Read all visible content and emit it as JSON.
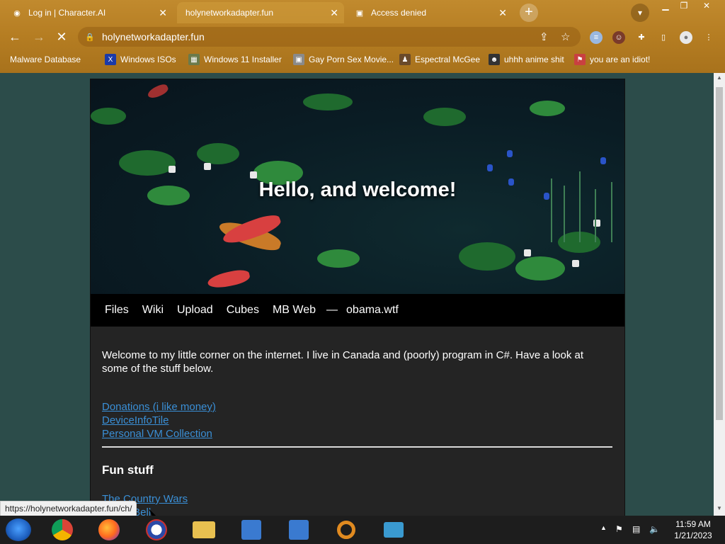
{
  "browser": {
    "tabs": [
      {
        "title": "Log in | Character.AI",
        "active": false
      },
      {
        "title": "holynetworkadapter.fun",
        "active": true
      },
      {
        "title": "Access denied",
        "active": false
      }
    ],
    "url": "holynetworkadapter.fun",
    "bookmarks": [
      "Malware Database",
      "Windows ISOs",
      "Windows 11 Installer",
      "Gay Porn Sex Movie...",
      "Espectral McGee",
      "uhhh anime shit",
      "you are an idiot!"
    ],
    "accent": "#b57d22"
  },
  "page": {
    "hero_title": "Hello, and welcome!",
    "nav": [
      "Files",
      "Wiki",
      "Upload",
      "Cubes",
      "MB Web"
    ],
    "nav_separator": "—",
    "nav_extra": "obama.wtf",
    "intro": "Welcome to my little corner on the internet. I live in Canada and (poorly) program in C#. Have a look at some of the stuff below.",
    "links": [
      "Donations (i like money)",
      "DeviceInfoTile",
      "Personal VM Collection"
    ],
    "section_title": "Fun stuff",
    "fun_links": [
      "The Country Wars",
      "Ferret Bell"
    ]
  },
  "status_url": "https://holynetworkadapter.fun/ch/",
  "taskbar": {
    "time": "11:59 AM",
    "date": "1/21/2023"
  }
}
